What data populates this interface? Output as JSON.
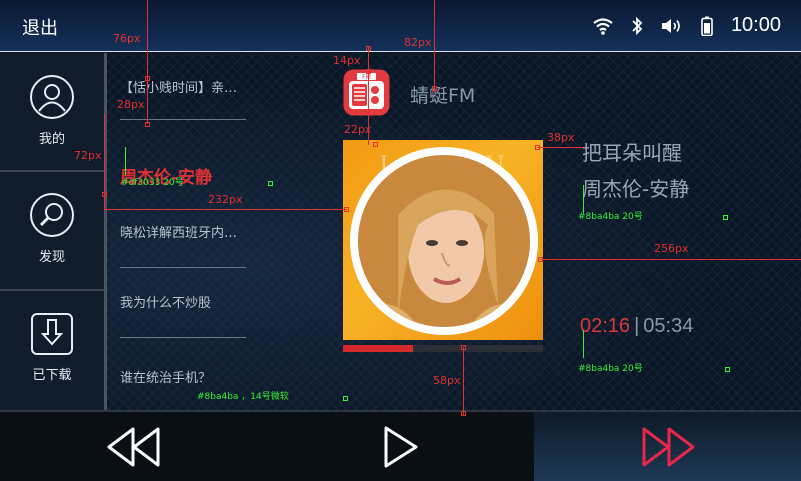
{
  "topbar": {
    "back_label": "退出",
    "time": "10:00",
    "icons": [
      "wifi-icon",
      "bluetooth-icon",
      "volume-icon",
      "battery-icon"
    ]
  },
  "nav": [
    {
      "label": "我的",
      "icon": "user-icon"
    },
    {
      "label": "发现",
      "icon": "search-icon"
    },
    {
      "label": "已下载",
      "icon": "download-icon"
    }
  ],
  "playlist": [
    {
      "title": "【恬小贱时间】亲…"
    },
    {
      "title": "周杰伦-安静"
    },
    {
      "title": "晓松详解西班牙内…"
    },
    {
      "title": "我为什么不炒股"
    },
    {
      "title": "谁在统治手机？"
    }
  ],
  "station": {
    "name": "蜻蜓FM",
    "icon_text": "FM"
  },
  "cover": {
    "text": "LARY DU"
  },
  "song": {
    "title": "把耳朵叫醒",
    "artist": "周杰伦-安静"
  },
  "playback": {
    "current": "02:16",
    "separator": "|",
    "total": "05:34",
    "progress": 0.35
  },
  "controls": {
    "prev": "rewind-icon",
    "play": "play-icon",
    "next": "fast-forward-icon"
  },
  "colors": {
    "accent_red": "#df3033",
    "text_grey": "#8ba4ba",
    "annotation_red": "#e03030",
    "annotation_green": "#38f038"
  },
  "annotations": {
    "dims": [
      "76px",
      "82px",
      "14px",
      "28px",
      "72px",
      "22px",
      "38px",
      "232px",
      "256px",
      "58px"
    ],
    "notes": [
      "#df3033  20号",
      "#8ba4ba  20号",
      "#8ba4ba  20号",
      "#8ba4ba ，14号微软"
    ]
  }
}
